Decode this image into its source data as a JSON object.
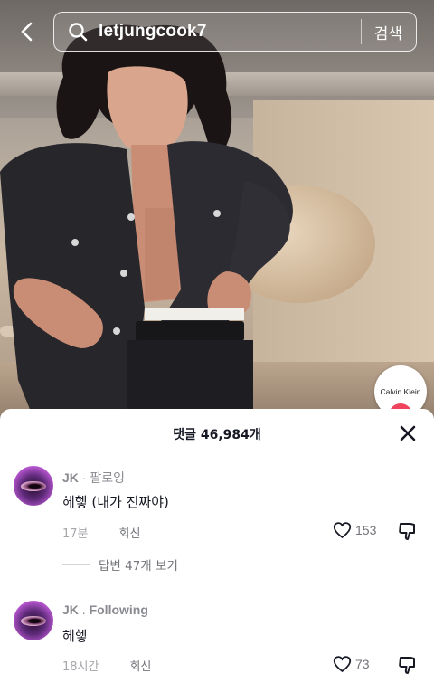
{
  "search": {
    "query": "letjungcook7",
    "button_label": "검색"
  },
  "video": {
    "brand_badge": "Calvin Klein"
  },
  "comments_sheet": {
    "title": "댓글 46,984개",
    "comments": [
      {
        "author": "JK",
        "separator": " · ",
        "relation": "팔로잉",
        "text": "헤헿 (내가 진짜야)",
        "time": "17분",
        "reply_label": "회신",
        "likes": "153",
        "view_replies": "답변 47개 보기"
      },
      {
        "author": "JK",
        "separator": " . ",
        "relation": "Following",
        "text": "헤헿",
        "time": "18시간",
        "reply_label": "회신",
        "likes": "73"
      }
    ]
  },
  "icons": {
    "back": "chevron-left-icon",
    "search": "search-icon",
    "close": "close-icon",
    "like": "heart-icon",
    "dislike": "thumbs-down-icon"
  },
  "colors": {
    "text_primary": "#161823",
    "text_secondary": "#8a8b91",
    "brand_accent": "#f0435c"
  }
}
